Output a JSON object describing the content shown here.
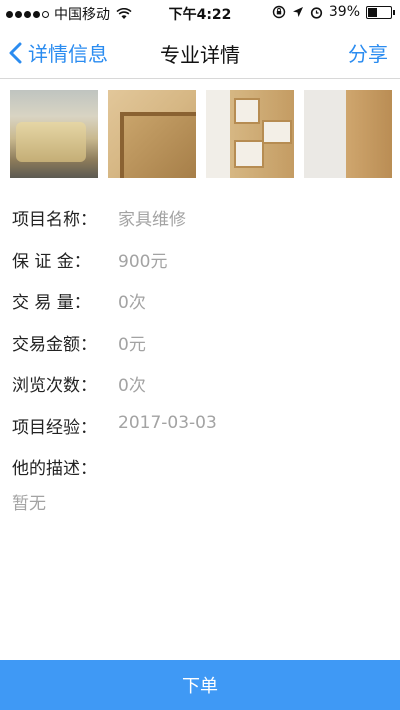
{
  "status_bar": {
    "carrier": "中国移动",
    "time": "下午4:22",
    "battery_percent": "39%",
    "battery_level": 0.39
  },
  "nav": {
    "back_label": "详情信息",
    "title": "专业详情",
    "share_label": "分享"
  },
  "photos": [
    {
      "name": "sofa-photo"
    },
    {
      "name": "cabinet-corner-photo"
    },
    {
      "name": "bookshelf-photo"
    },
    {
      "name": "board-photo"
    }
  ],
  "details": [
    {
      "label": "项目名称：",
      "value": "家具维修"
    },
    {
      "label": "保 证 金：",
      "value": "900元"
    },
    {
      "label": "交 易 量：",
      "value": "0次"
    },
    {
      "label": "交易金额：",
      "value": "0元"
    },
    {
      "label": "浏览次数：",
      "value": "0次"
    },
    {
      "label": "项目经验：",
      "value": "2017-03-03"
    }
  ],
  "description": {
    "label": "他的描述：",
    "text": "暂无"
  },
  "order_button": {
    "label": "下单"
  },
  "colors": {
    "accent": "#2b8cf0",
    "button": "#3f99f5",
    "muted_text": "#a3a3a3"
  }
}
